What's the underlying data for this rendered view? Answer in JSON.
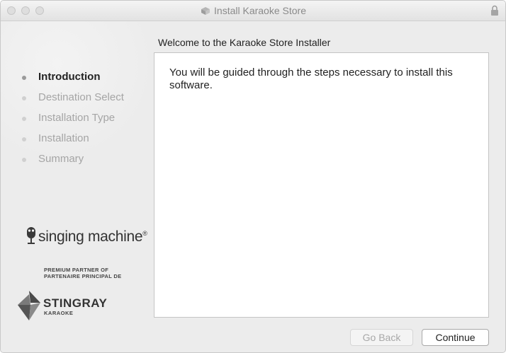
{
  "window": {
    "title": "Install Karaoke Store"
  },
  "steps": [
    {
      "label": "Introduction",
      "active": true
    },
    {
      "label": "Destination Select",
      "active": false
    },
    {
      "label": "Installation Type",
      "active": false
    },
    {
      "label": "Installation",
      "active": false
    },
    {
      "label": "Summary",
      "active": false
    }
  ],
  "branding": {
    "singing_machine": "singing machine",
    "singing_machine_mark": "®",
    "partner_line1": "PREMIUM PARTNER OF",
    "partner_line2": "PARTENAIRE PRINCIPAL DE",
    "stingray_name": "STINGRAY",
    "stingray_sub": "KARAOKE"
  },
  "main": {
    "heading": "Welcome to the Karaoke Store Installer",
    "body": "You will be guided through the steps necessary to install this software."
  },
  "buttons": {
    "back": "Go Back",
    "continue": "Continue"
  },
  "icons": [
    "package-icon",
    "lock-icon",
    "microphone-icon",
    "stingray-logo-icon"
  ]
}
